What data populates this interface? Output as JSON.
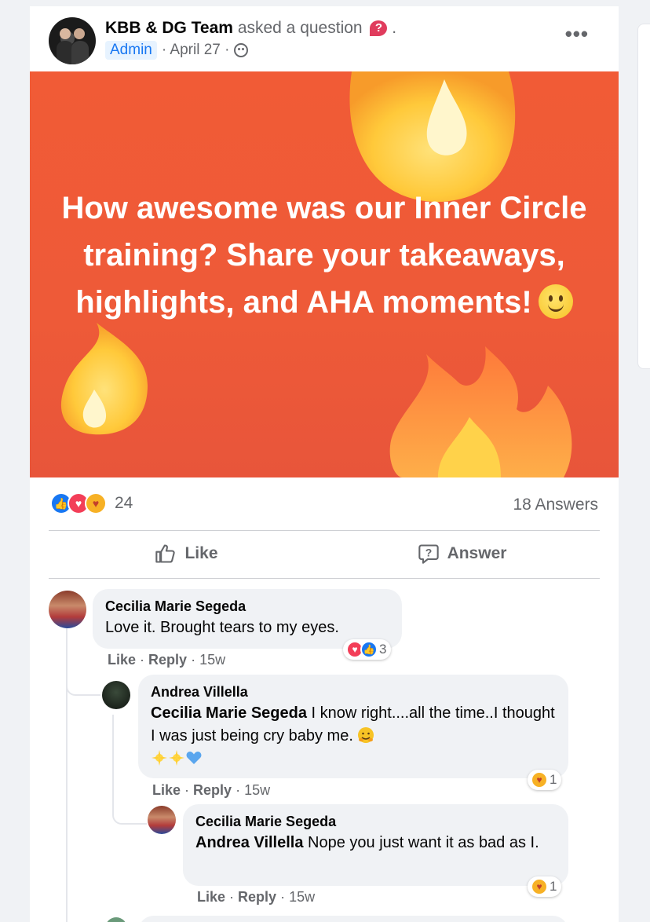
{
  "post": {
    "page_name": "KBB & DG Team",
    "action_text": "asked a question",
    "question_badge": "?",
    "trailing_dot": ".",
    "role_badge": "Admin",
    "date": "· April 27 ·",
    "more_label": "•••",
    "banner_text": "How awesome was our Inner Circle training? Share your takeaways, highlights, and AHA moments!",
    "reaction_count": "24",
    "answers_count": "18 Answers"
  },
  "actions": {
    "like_label": "Like",
    "answer_label": "Answer"
  },
  "comments": [
    {
      "author": "Cecilia Marie Segeda",
      "text": "Love it. Brought tears to my eyes.",
      "like": "Like",
      "reply": "Reply",
      "age": "15w",
      "reaction_count": "3"
    },
    {
      "author": "Andrea Villella",
      "mention": "Cecilia Marie Segeda",
      "text": "I know right....all the time..I thought I was just being cry baby me.",
      "like": "Like",
      "reply": "Reply",
      "age": "15w",
      "reaction_count": "1"
    },
    {
      "author": "Cecilia Marie Segeda",
      "mention": "Andrea Villella",
      "text": "Nope you just want it as bad as I.",
      "like": "Like",
      "reply": "Reply",
      "age": "15w",
      "reaction_count": "1"
    }
  ],
  "colors": {
    "banner_top": "#f15b36",
    "like_blue": "#1877f2",
    "love_red": "#f33e58",
    "care_yellow": "#f7b125"
  },
  "icons": [
    "question-badge-icon",
    "globe-icon",
    "more-icon",
    "fire-icon",
    "smiley-icon",
    "like-reaction-icon",
    "love-reaction-icon",
    "care-reaction-icon",
    "thumb-icon",
    "answer-icon",
    "sparkle-icon",
    "blue-heart-icon"
  ]
}
